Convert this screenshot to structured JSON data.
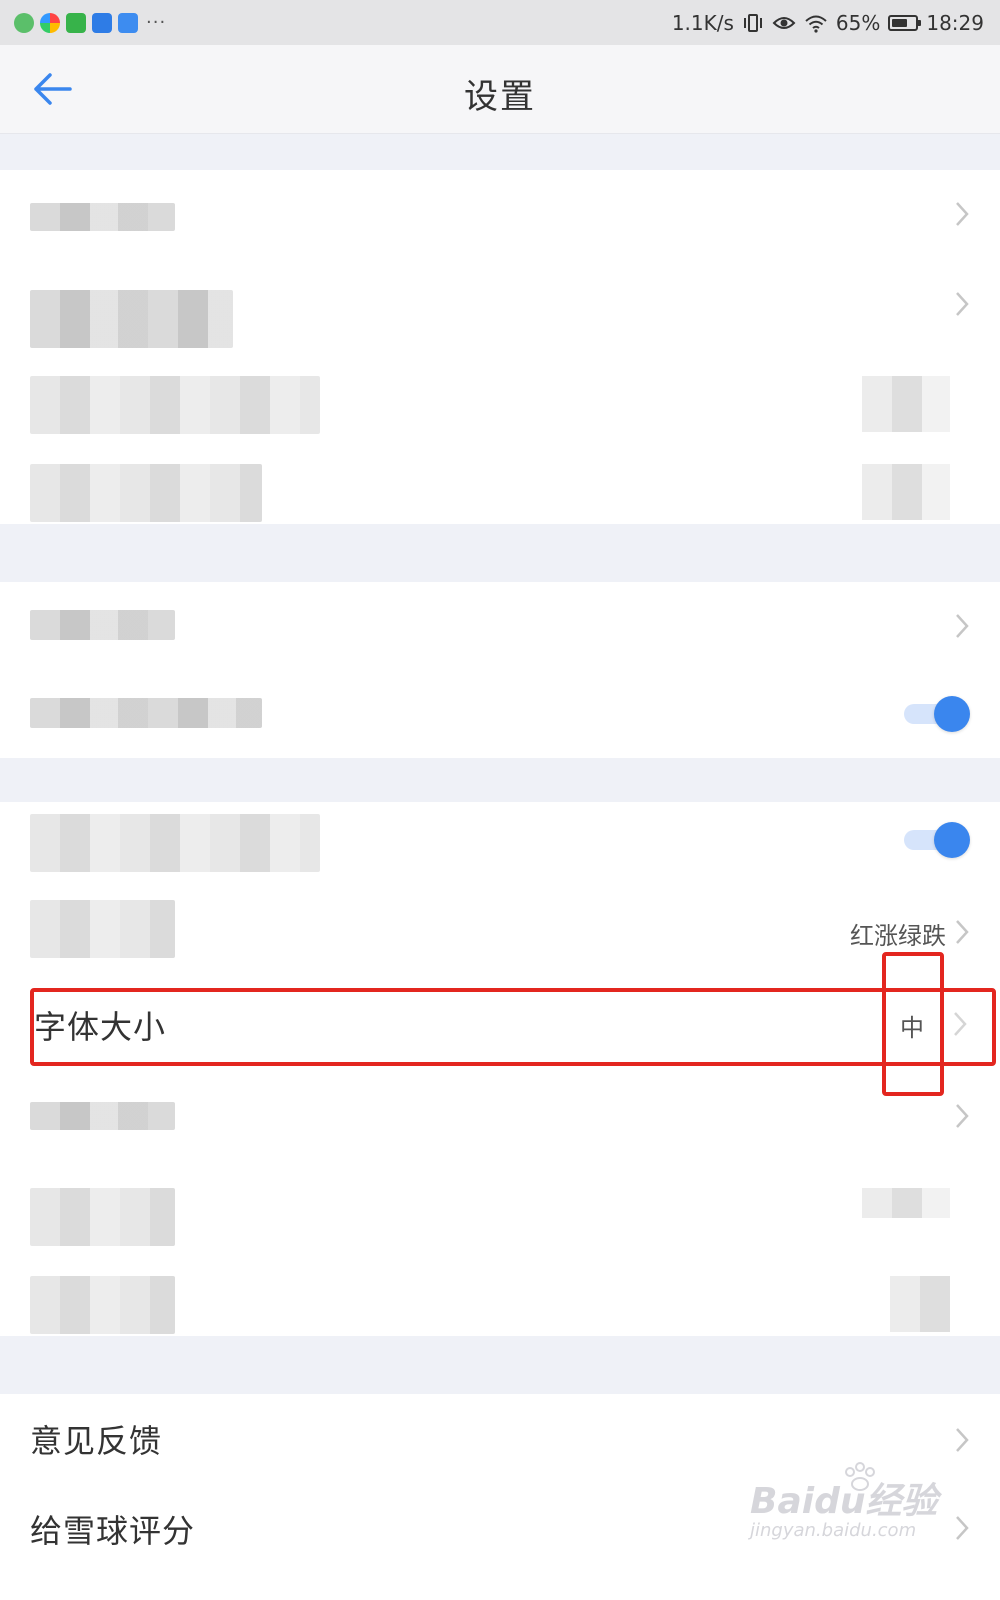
{
  "status_bar": {
    "speed": "1.1K/s",
    "battery": "65%",
    "battery_level": 0.65,
    "time": "18:29",
    "overflow": "···"
  },
  "header": {
    "title": "设置",
    "back_icon": "arrow-left-icon",
    "accent_color": "#3a86ee"
  },
  "rows": {
    "color_scheme": {
      "value": "红涨绿跌"
    },
    "font_size": {
      "label": "字体大小",
      "value": "中"
    },
    "feedback": {
      "label": "意见反馈"
    },
    "rate": {
      "label": "给雪球评分"
    }
  },
  "toggles": [
    {
      "on": true
    },
    {
      "on": true
    }
  ],
  "annotations": {
    "highlight_color": "#e3261f"
  },
  "watermark": {
    "main": "Baidu经验",
    "sub": "jingyan.baidu.com"
  }
}
